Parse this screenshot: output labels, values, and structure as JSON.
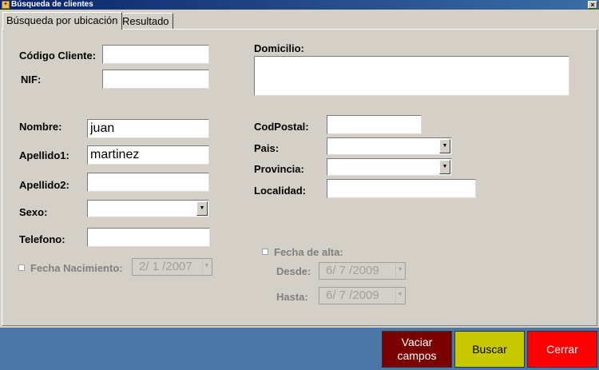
{
  "window": {
    "title": "Búsqueda de clientes",
    "close_glyph": "×",
    "app_icon_glyph": "✦"
  },
  "tabs": [
    {
      "label": "Búsqueda por ubicación",
      "active": true
    },
    {
      "label": "Resultado",
      "active": false
    }
  ],
  "form": {
    "codigo_cliente": {
      "label": "Código Cliente:",
      "value": ""
    },
    "nif": {
      "label": "NIF:",
      "value": ""
    },
    "nombre": {
      "label": "Nombre:",
      "value": "juan"
    },
    "apellido1": {
      "label": "Apellido1:",
      "value": "martinez"
    },
    "apellido2": {
      "label": "Apellido2:",
      "value": ""
    },
    "sexo": {
      "label": "Sexo:",
      "value": ""
    },
    "telefono": {
      "label": "Telefono:",
      "value": ""
    },
    "fecha_nacimiento": {
      "label": "Fecha Nacimiento:",
      "value": "2/ 1 /2007",
      "checked": false
    },
    "domicilio": {
      "label": "Domicilio:",
      "value": ""
    },
    "codpostal": {
      "label": "CodPostal:",
      "value": ""
    },
    "pais": {
      "label": "Pais:",
      "value": ""
    },
    "provincia": {
      "label": "Provincia:",
      "value": ""
    },
    "localidad": {
      "label": "Localidad:",
      "value": ""
    },
    "fecha_alta": {
      "label": "Fecha de alta:",
      "checked": false,
      "desde_label": "Desde:",
      "desde_value": "6/ 7 /2009",
      "hasta_label": "Hasta:",
      "hasta_value": "6/ 7 /2009"
    }
  },
  "icons": {
    "dropdown_arrow": "▼"
  },
  "buttons": {
    "vaciar": "Vaciar campos",
    "buscar": "Buscar",
    "cerrar": "Cerrar"
  },
  "colors": {
    "vaciar_bg": "#7a0000",
    "buscar_bg": "#c8c800",
    "cerrar_bg": "#ff0000",
    "footer_bg": "#4a76a8",
    "window_bg": "#d4d0c8"
  }
}
